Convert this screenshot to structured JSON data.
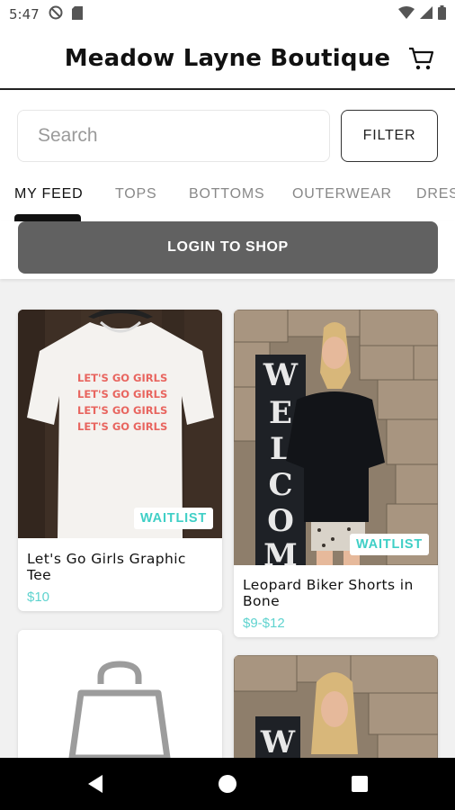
{
  "status_bar": {
    "time": "5:47"
  },
  "app": {
    "title": "Meadow Layne Boutique"
  },
  "search": {
    "placeholder": "Search",
    "filter_label": "FILTER"
  },
  "tabs": [
    {
      "label": "MY FEED",
      "active": true
    },
    {
      "label": "TOPS"
    },
    {
      "label": "BOTTOMS"
    },
    {
      "label": "OUTERWEAR"
    },
    {
      "label": "DRES"
    }
  ],
  "login": {
    "label": "LOGIN TO SHOP"
  },
  "products": [
    {
      "name": "Let's Go Girls Graphic Tee",
      "price": "$10",
      "badge": "WAITLIST",
      "shirt_text": [
        "LET'S GO GIRLS",
        "LET'S GO GIRLS",
        "LET'S GO GIRLS",
        "LET'S GO GIRLS"
      ]
    },
    {
      "name": "Leopard Biker Shorts in Bone",
      "price": "$9-$12",
      "badge": "WAITLIST",
      "sign_text": [
        "W",
        "E",
        "L",
        "C",
        "O",
        "M"
      ]
    },
    {
      "name": "",
      "price": "",
      "placeholder_icon": "shopping-bag-icon"
    },
    {
      "name": "",
      "price": "",
      "sign_text": [
        "W"
      ]
    }
  ],
  "colors": {
    "accent": "#5fd3cf",
    "button": "#616161",
    "nav": "#000000"
  },
  "icons": [
    "dnd-icon",
    "sd-card-icon",
    "wifi-icon",
    "signal-icon",
    "battery-icon",
    "cart-icon",
    "back-icon",
    "home-icon",
    "recents-icon"
  ]
}
